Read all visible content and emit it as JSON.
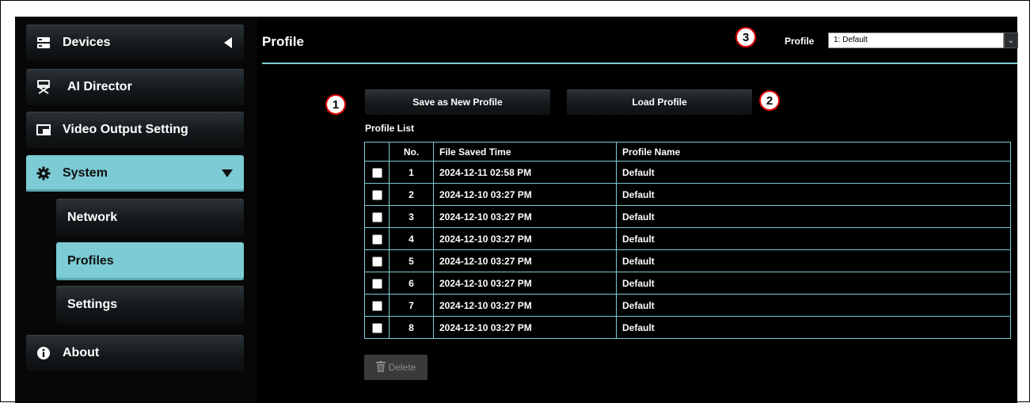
{
  "sidebar": {
    "items": [
      {
        "label": "Devices",
        "icon": "server-icon"
      },
      {
        "label": "AI Director",
        "icon": "director-chair-icon"
      },
      {
        "label": "Video Output Setting",
        "icon": "window-icon"
      },
      {
        "label": "System",
        "icon": "gear-icon"
      },
      {
        "label": "About",
        "icon": "info-icon"
      }
    ],
    "subitems": [
      {
        "label": "Network"
      },
      {
        "label": "Profiles"
      },
      {
        "label": "Settings"
      }
    ]
  },
  "header": {
    "title": "Profile",
    "profile_label": "Profile",
    "profile_select_value": "1: Default"
  },
  "callouts": [
    "1",
    "2",
    "3"
  ],
  "actions": {
    "save_label": "Save as New Profile",
    "load_label": "Load Profile",
    "delete_label": "Delete"
  },
  "profile_list": {
    "caption": "Profile List",
    "columns": [
      "No.",
      "File Saved Time",
      "Profile Name"
    ],
    "rows": [
      {
        "no": "1",
        "time": "2024-12-11 02:58 PM",
        "name": "Default"
      },
      {
        "no": "2",
        "time": "2024-12-10 03:27 PM",
        "name": "Default"
      },
      {
        "no": "3",
        "time": "2024-12-10 03:27 PM",
        "name": "Default"
      },
      {
        "no": "4",
        "time": "2024-12-10 03:27 PM",
        "name": "Default"
      },
      {
        "no": "5",
        "time": "2024-12-10 03:27 PM",
        "name": "Default"
      },
      {
        "no": "6",
        "time": "2024-12-10 03:27 PM",
        "name": "Default"
      },
      {
        "no": "7",
        "time": "2024-12-10 03:27 PM",
        "name": "Default"
      },
      {
        "no": "8",
        "time": "2024-12-10 03:27 PM",
        "name": "Default"
      }
    ]
  },
  "colors": {
    "accent": "#7dcbd4",
    "background": "#000000",
    "callout_border": "#e00000"
  }
}
